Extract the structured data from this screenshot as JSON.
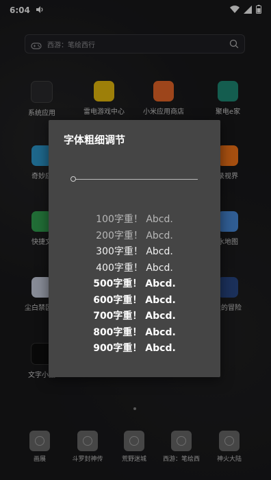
{
  "status_bar": {
    "time": "6:04"
  },
  "search": {
    "placeholder": "西游：笔绘西行"
  },
  "apps": [
    {
      "label": "系统应用",
      "color": "#2b2b2f"
    },
    {
      "label": "雷电游戏中心",
      "color": "#f1c40f"
    },
    {
      "label": "小米应用商店",
      "color": "#f26b2a"
    },
    {
      "label": "聚电e家",
      "color": "#1f8f7a"
    },
    {
      "label": "奇妙应",
      "color": "#2f9fd6"
    },
    {
      "label": "录视界",
      "color": "#ff7a1a"
    },
    {
      "label": "快捷文",
      "color": "#34a853"
    },
    {
      "label": "水地图",
      "color": "#4a90e2"
    },
    {
      "label": "尘白禁区武",
      "color": "#cfd6e6"
    },
    {
      "label": "尘的冒险",
      "color": "#2a4a8a"
    },
    {
      "label": "文字小品",
      "color": "#0f0f0f"
    }
  ],
  "dock": [
    {
      "label": "画展"
    },
    {
      "label": "斗罗封神传"
    },
    {
      "label": "荒野迷城"
    },
    {
      "label": "西游：笔绘西"
    },
    {
      "label": "神火大陆"
    }
  ],
  "dialog": {
    "title": "字体粗细调节",
    "slider_level": 0,
    "samples": [
      {
        "text": "100字重！ Abcd.",
        "weight": 100
      },
      {
        "text": "200字重！ Abcd.",
        "weight": 200
      },
      {
        "text": "300字重！ Abcd.",
        "weight": 300
      },
      {
        "text": "400字重！ Abcd.",
        "weight": 400
      },
      {
        "text": "500字重！ Abcd.",
        "weight": 500
      },
      {
        "text": "600字重！ Abcd.",
        "weight": 600
      },
      {
        "text": "700字重！ Abcd.",
        "weight": 700
      },
      {
        "text": "800字重！ Abcd.",
        "weight": 800
      },
      {
        "text": "900字重！ Abcd.",
        "weight": 900
      }
    ]
  }
}
